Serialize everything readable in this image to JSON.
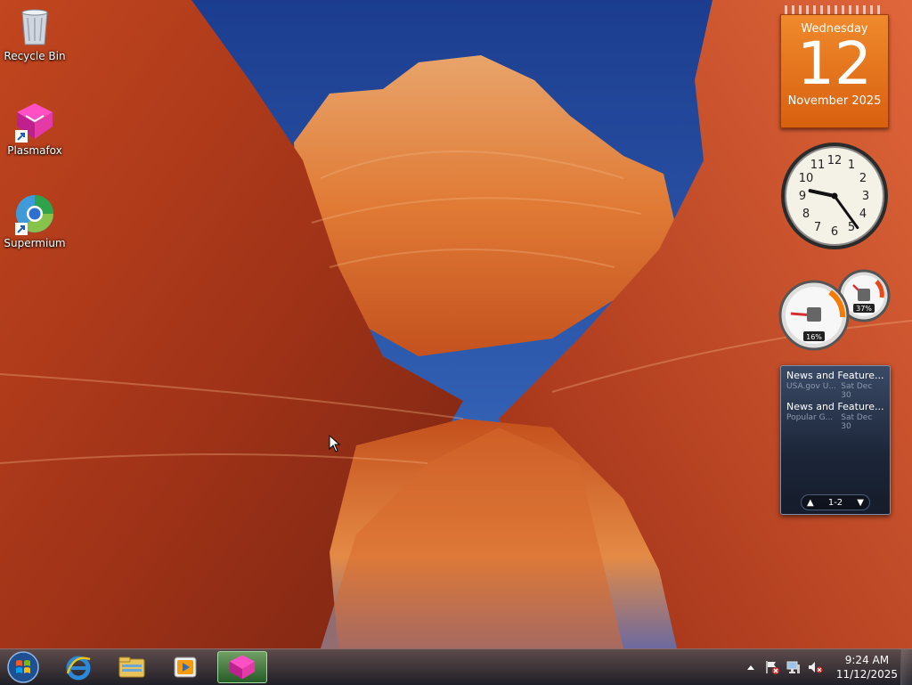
{
  "desktop_icons": [
    {
      "label": "Recycle Bin",
      "icon": "recycle-bin-icon"
    },
    {
      "label": "Plasmafox",
      "icon": "plasmafox-icon"
    },
    {
      "label": "Supermium",
      "icon": "supermium-icon"
    }
  ],
  "calendar": {
    "weekday": "Wednesday",
    "day": "12",
    "month_year": "November 2025"
  },
  "clock_gadget": {
    "time": "9:24"
  },
  "cpu_meter": {
    "cpu_percent": "16%",
    "memory_percent": "37%"
  },
  "news_gadget": {
    "items": [
      {
        "title": "News and Feature...",
        "source": "USA.gov U...",
        "date": "Sat Dec 30"
      },
      {
        "title": "News and Feature...",
        "source": "Popular G...",
        "date": "Sat Dec 30"
      }
    ],
    "page_label": "1-2"
  },
  "taskbar": {
    "start_icon": "windows-orb-icon",
    "pinned": [
      {
        "name": "internet-explorer-icon"
      },
      {
        "name": "file-explorer-icon"
      },
      {
        "name": "media-player-icon"
      },
      {
        "name": "plasmafox-icon",
        "active": true
      }
    ],
    "tray": {
      "time": "9:24 AM",
      "date": "11/12/2025"
    }
  },
  "colors": {
    "calendar_orange": "#e8701a",
    "taskbar_active": "#5ccf4f",
    "wall_red": "#b8391c"
  }
}
